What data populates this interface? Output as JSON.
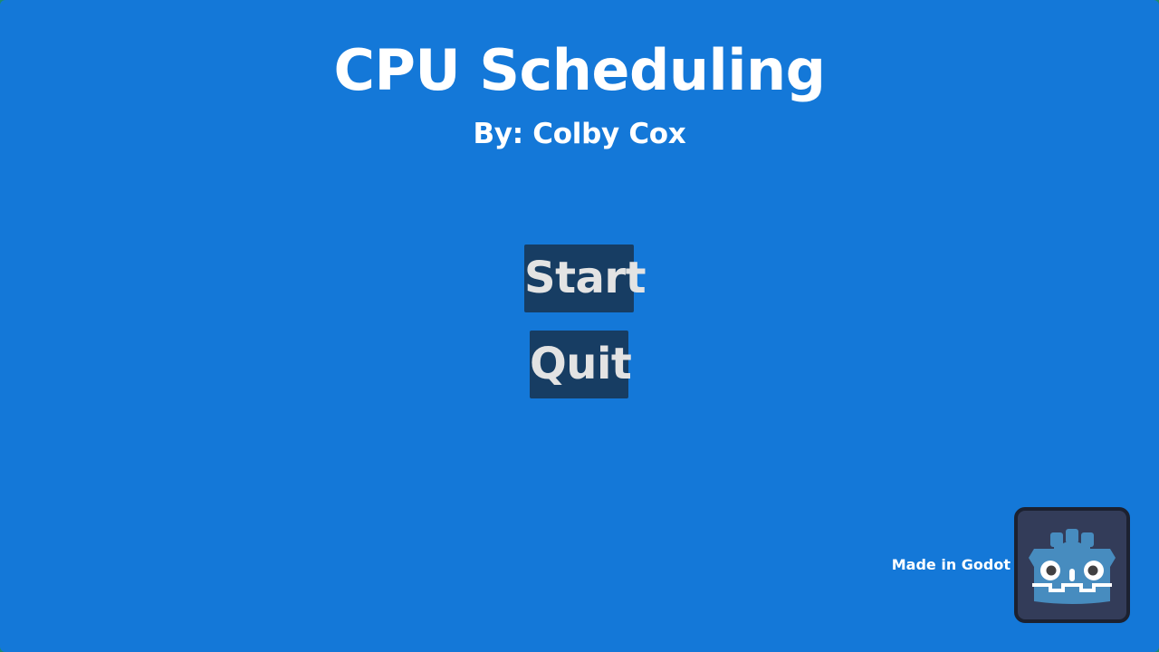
{
  "title": "CPU Scheduling",
  "subtitle": "By: Colby Cox",
  "menu": {
    "start_label": "Start",
    "quit_label": "Quit"
  },
  "badge": {
    "text": "Made in Godot",
    "logo_icon": "godot-logo-icon"
  },
  "colors": {
    "background": "#1478d8",
    "button_bg": "#173d63",
    "button_text": "#e3e3e3",
    "badge_bg": "#333c59",
    "logo": "#478cbf"
  }
}
